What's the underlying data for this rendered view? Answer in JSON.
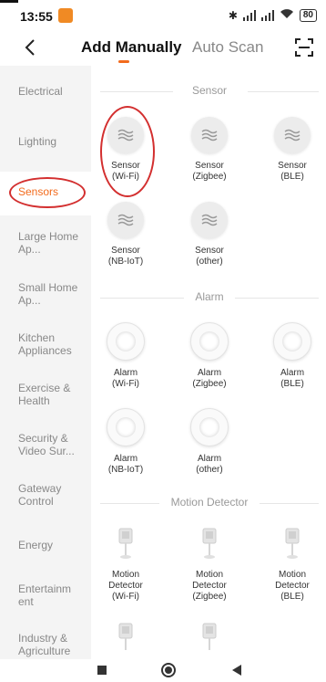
{
  "status": {
    "time": "13:55",
    "battery": "80"
  },
  "header": {
    "tab_active": "Add Manually",
    "tab_inactive": "Auto Scan"
  },
  "sidebar": {
    "items": [
      {
        "label": "Electrical"
      },
      {
        "label": "Lighting"
      },
      {
        "label": "Sensors"
      },
      {
        "label": "Large Home Ap..."
      },
      {
        "label": "Small Home Ap..."
      },
      {
        "label": "Kitchen Appliances"
      },
      {
        "label": "Exercise & Health"
      },
      {
        "label": "Security & Video Sur..."
      },
      {
        "label": "Gateway Control"
      },
      {
        "label": "Energy"
      },
      {
        "label": "Entertainm ent"
      },
      {
        "label": "Industry & Agriculture"
      }
    ]
  },
  "sections": {
    "sensor": {
      "title": "Sensor",
      "devices": [
        {
          "l1": "Sensor",
          "l2": "(Wi-Fi)"
        },
        {
          "l1": "Sensor",
          "l2": "(Zigbee)"
        },
        {
          "l1": "Sensor",
          "l2": "(BLE)"
        },
        {
          "l1": "Sensor",
          "l2": "(NB-IoT)"
        },
        {
          "l1": "Sensor",
          "l2": "(other)"
        }
      ]
    },
    "alarm": {
      "title": "Alarm",
      "devices": [
        {
          "l1": "Alarm",
          "l2": "(Wi-Fi)"
        },
        {
          "l1": "Alarm",
          "l2": "(Zigbee)"
        },
        {
          "l1": "Alarm",
          "l2": "(BLE)"
        },
        {
          "l1": "Alarm",
          "l2": "(NB-IoT)"
        },
        {
          "l1": "Alarm",
          "l2": "(other)"
        }
      ]
    },
    "motion": {
      "title": "Motion Detector",
      "devices": [
        {
          "l1": "Motion",
          "l2": "Detector",
          "l3": "(Wi-Fi)"
        },
        {
          "l1": "Motion",
          "l2": "Detector",
          "l3": "(Zigbee)"
        },
        {
          "l1": "Motion",
          "l2": "Detector",
          "l3": "(BLE)"
        }
      ]
    }
  },
  "colors": {
    "accent": "#f26b1d",
    "annotation": "#d32f2f"
  }
}
